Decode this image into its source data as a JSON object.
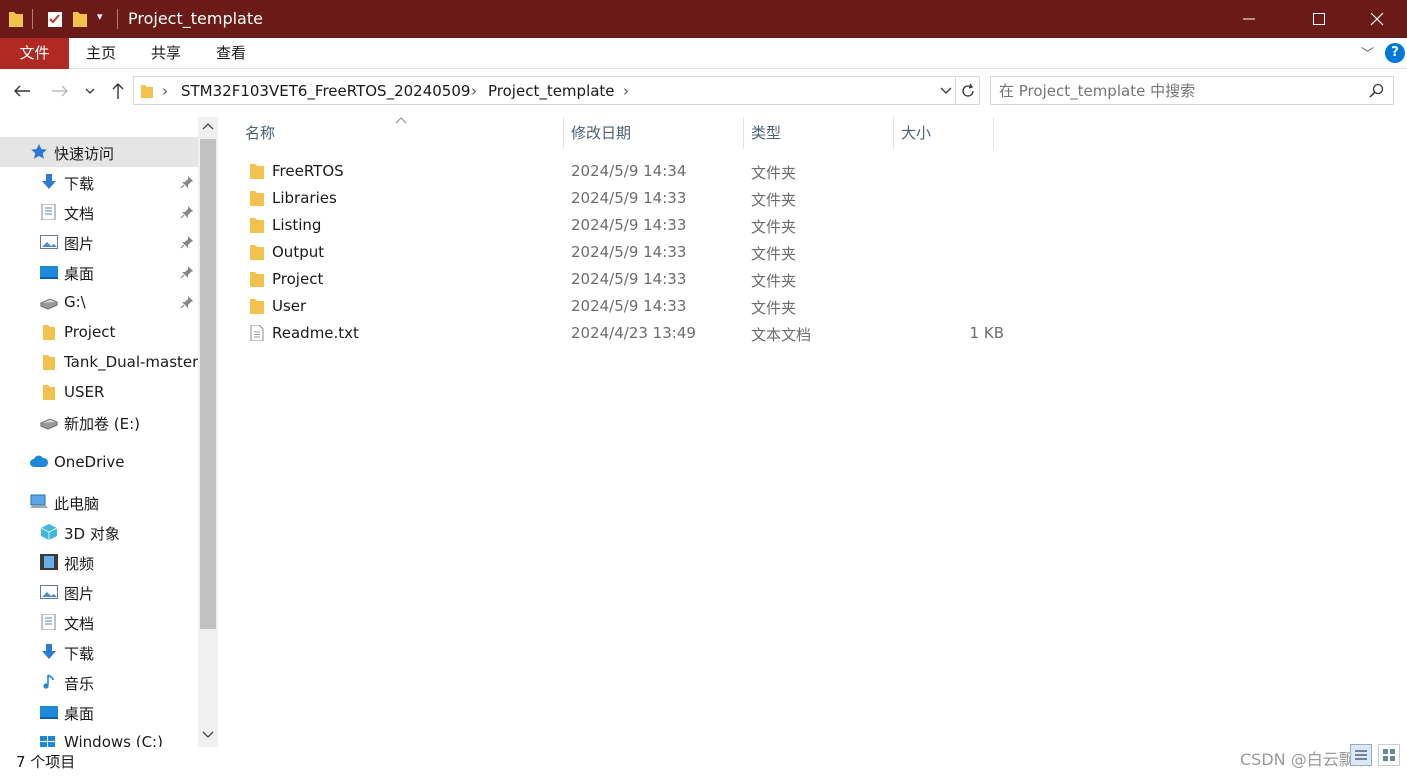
{
  "window": {
    "title": "Project_template"
  },
  "ribbon": {
    "tabs": [
      "文件",
      "主页",
      "共享",
      "查看"
    ]
  },
  "address": {
    "crumbs": [
      "STM32F103VET6_FreeRTOS_20240509",
      "Project_template"
    ],
    "search_placeholder": "在 Project_template 中搜索"
  },
  "nav": {
    "quick_access": "快速访问",
    "items": [
      {
        "label": "下载",
        "icon": "download-arrow-icon",
        "pinned": true
      },
      {
        "label": "文档",
        "icon": "document-icon",
        "pinned": true
      },
      {
        "label": "图片",
        "icon": "pictures-icon",
        "pinned": true
      },
      {
        "label": "桌面",
        "icon": "desktop-icon",
        "pinned": true
      },
      {
        "label": "G:\\",
        "icon": "drive-icon",
        "pinned": true
      },
      {
        "label": "Project",
        "icon": "folder-icon",
        "pinned": false
      },
      {
        "label": "Tank_Dual-master",
        "icon": "folder-icon",
        "pinned": false
      },
      {
        "label": "USER",
        "icon": "folder-icon",
        "pinned": false
      },
      {
        "label": "新加卷 (E:)",
        "icon": "drive-icon",
        "pinned": false
      }
    ],
    "onedrive": "OneDrive",
    "this_pc": "此电脑",
    "pc_items": [
      {
        "label": "3D 对象",
        "icon": "3d-objects-icon"
      },
      {
        "label": "视频",
        "icon": "video-icon"
      },
      {
        "label": "图片",
        "icon": "pictures-icon"
      },
      {
        "label": "文档",
        "icon": "document-icon"
      },
      {
        "label": "下载",
        "icon": "download-arrow-icon"
      },
      {
        "label": "音乐",
        "icon": "music-icon"
      },
      {
        "label": "桌面",
        "icon": "desktop-icon"
      },
      {
        "label": "Windows (C:)",
        "icon": "windows-drive-icon"
      }
    ]
  },
  "columns": {
    "name": "名称",
    "date": "修改日期",
    "type": "类型",
    "size": "大小"
  },
  "files": [
    {
      "name": "FreeRTOS",
      "date": "2024/5/9 14:34",
      "type": "文件夹",
      "size": "",
      "icon": "folder-icon"
    },
    {
      "name": "Libraries",
      "date": "2024/5/9 14:33",
      "type": "文件夹",
      "size": "",
      "icon": "folder-icon"
    },
    {
      "name": "Listing",
      "date": "2024/5/9 14:33",
      "type": "文件夹",
      "size": "",
      "icon": "folder-icon"
    },
    {
      "name": "Output",
      "date": "2024/5/9 14:33",
      "type": "文件夹",
      "size": "",
      "icon": "folder-icon"
    },
    {
      "name": "Project",
      "date": "2024/5/9 14:33",
      "type": "文件夹",
      "size": "",
      "icon": "folder-icon"
    },
    {
      "name": "User",
      "date": "2024/5/9 14:33",
      "type": "文件夹",
      "size": "",
      "icon": "folder-icon"
    },
    {
      "name": "Readme.txt",
      "date": "2024/4/23 13:49",
      "type": "文本文档",
      "size": "1 KB",
      "icon": "text-file-icon"
    }
  ],
  "status": {
    "count": "7 个项目"
  },
  "watermark": "CSDN @白云飘泊",
  "colors": {
    "titlebar": "#6b1b17",
    "file_tab": "#b02a23",
    "folder": "#f2c14e",
    "accent": "#0078d7"
  }
}
